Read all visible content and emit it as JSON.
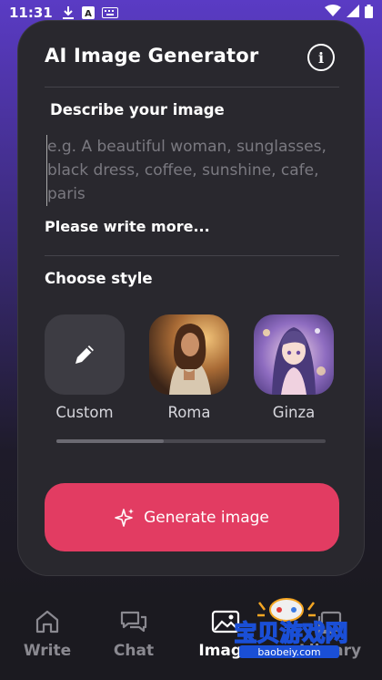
{
  "status_bar": {
    "time": "11:31"
  },
  "card": {
    "title": "AI Image Generator",
    "info_label": "i",
    "describe_label": "Describe your image",
    "prompt_placeholder": "e.g. A beautiful woman, sunglasses, black dress, coffee, sunshine, cafe, paris",
    "hint": "Please write more...",
    "choose_style_label": "Choose style",
    "styles": [
      {
        "name": "Custom",
        "icon": "pencil-icon"
      },
      {
        "name": "Roma",
        "icon": "portrait-roma"
      },
      {
        "name": "Ginza",
        "icon": "portrait-ginza"
      }
    ],
    "style_scroll_position": 0.0,
    "generate_label": "Generate image",
    "accent_color": "#e23c62"
  },
  "nav": {
    "items": [
      {
        "label": "Write",
        "icon": "home-icon",
        "active": false
      },
      {
        "label": "Chat",
        "icon": "chat-icon",
        "active": false
      },
      {
        "label": "Image",
        "icon": "image-icon",
        "active": true
      },
      {
        "label": "Library",
        "icon": "library-icon",
        "active": false
      }
    ]
  },
  "watermark": {
    "text": "宝贝游戏网",
    "url": "baobeiy.com"
  }
}
